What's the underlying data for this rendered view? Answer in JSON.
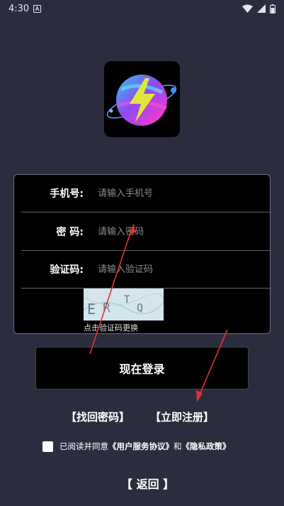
{
  "status_bar": {
    "time": "4:30",
    "icons": [
      "notification-a-icon",
      "wifi-icon",
      "signal-icon",
      "battery-icon"
    ]
  },
  "logo": {
    "icon": "lightning-planet-logo"
  },
  "form": {
    "phone_label": "手机号:",
    "phone_placeholder": "请输入手机号",
    "password_label": "密 码:",
    "password_placeholder": "请输入密码",
    "code_label": "验证码:",
    "code_placeholder": "请输入验证码",
    "captcha_text": "ERTQ",
    "captcha_hint": "点击验证码更换"
  },
  "login_button": "现在登录",
  "links": {
    "forgot": "【找回密码】",
    "register": "【立即注册】"
  },
  "agreement": {
    "prefix": "已阅读并同意",
    "user_agreement": "《用户服务协议》",
    "and": "和",
    "privacy": "《隐私政策》"
  },
  "back_button": "【 返回 】",
  "colors": {
    "background": "#2b2d3f",
    "card": "#000000",
    "annotation_arrow": "#e0312f"
  }
}
